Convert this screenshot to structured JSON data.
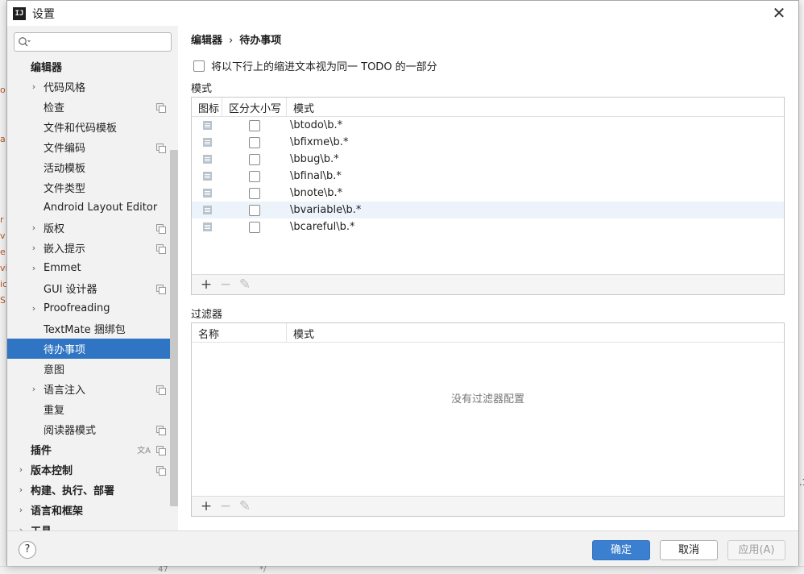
{
  "window": {
    "title": "设置"
  },
  "search": {
    "placeholder": "",
    "value": ""
  },
  "sidebar": {
    "items": [
      {
        "label": "编辑器",
        "bold": true,
        "indent": 0,
        "chevron": false,
        "icon": ""
      },
      {
        "label": "代码风格",
        "indent": 1,
        "chevron": true,
        "icon": ""
      },
      {
        "label": "检查",
        "indent": 1,
        "chevron": false,
        "icon": "project-icon"
      },
      {
        "label": "文件和代码模板",
        "indent": 1,
        "chevron": false,
        "icon": ""
      },
      {
        "label": "文件编码",
        "indent": 1,
        "chevron": false,
        "icon": "project-icon"
      },
      {
        "label": "活动模板",
        "indent": 1,
        "chevron": false,
        "icon": ""
      },
      {
        "label": "文件类型",
        "indent": 1,
        "chevron": false,
        "icon": ""
      },
      {
        "label": "Android Layout Editor",
        "indent": 1,
        "chevron": false,
        "icon": ""
      },
      {
        "label": "版权",
        "indent": 1,
        "chevron": true,
        "icon": "project-icon"
      },
      {
        "label": "嵌入提示",
        "indent": 1,
        "chevron": true,
        "icon": "project-icon"
      },
      {
        "label": "Emmet",
        "indent": 1,
        "chevron": true,
        "icon": ""
      },
      {
        "label": "GUI 设计器",
        "indent": 1,
        "chevron": false,
        "icon": "project-icon"
      },
      {
        "label": "Proofreading",
        "indent": 1,
        "chevron": true,
        "icon": ""
      },
      {
        "label": "TextMate 捆绑包",
        "indent": 1,
        "chevron": false,
        "icon": ""
      },
      {
        "label": "待办事项",
        "indent": 1,
        "chevron": false,
        "icon": "",
        "selected": true
      },
      {
        "label": "意图",
        "indent": 1,
        "chevron": false,
        "icon": ""
      },
      {
        "label": "语言注入",
        "indent": 1,
        "chevron": true,
        "icon": "project-icon"
      },
      {
        "label": "重复",
        "indent": 1,
        "chevron": false,
        "icon": ""
      },
      {
        "label": "阅读器模式",
        "indent": 1,
        "chevron": false,
        "icon": "project-icon"
      },
      {
        "label": "插件",
        "bold": true,
        "indent": 0,
        "chevron": false,
        "icon": "project-icon",
        "extra_icon": "translate-icon"
      },
      {
        "label": "版本控制",
        "bold": true,
        "indent": 0,
        "chevron": true,
        "icon": "project-icon"
      },
      {
        "label": "构建、执行、部署",
        "bold": true,
        "indent": 0,
        "chevron": true,
        "icon": ""
      },
      {
        "label": "语言和框架",
        "bold": true,
        "indent": 0,
        "chevron": true,
        "icon": ""
      },
      {
        "label": "工具",
        "bold": true,
        "indent": 0,
        "chevron": true,
        "icon": ""
      }
    ]
  },
  "breadcrumb": {
    "parent": "编辑器",
    "separator": "›",
    "current": "待办事项"
  },
  "options": {
    "multiline_label": "将以下行上的缩进文本视为同一 TODO 的一部分",
    "multiline_checked": false
  },
  "patterns": {
    "section_label": "模式",
    "columns": {
      "icon": "图标",
      "case": "区分大小写",
      "pattern": "模式"
    },
    "rows": [
      {
        "pattern": "\\btodo\\b.*",
        "case_sensitive": false
      },
      {
        "pattern": "\\bfixme\\b.*",
        "case_sensitive": false
      },
      {
        "pattern": "\\bbug\\b.*",
        "case_sensitive": false
      },
      {
        "pattern": "\\bfinal\\b.*",
        "case_sensitive": false
      },
      {
        "pattern": "\\bnote\\b.*",
        "case_sensitive": false
      },
      {
        "pattern": "\\bvariable\\b.*",
        "case_sensitive": false
      },
      {
        "pattern": "\\bcareful\\b.*",
        "case_sensitive": false
      }
    ],
    "toolbar": {
      "add": "+",
      "remove": "−",
      "edit": "✎"
    }
  },
  "filters": {
    "section_label": "过滤器",
    "columns": {
      "name": "名称",
      "pattern": "模式"
    },
    "empty_text": "没有过滤器配置",
    "toolbar": {
      "add": "+",
      "remove": "−",
      "edit": "✎"
    }
  },
  "footer": {
    "help": "?",
    "ok": "确定",
    "cancel": "取消",
    "apply": "应用(A)"
  },
  "background": {
    "left_chars": [
      "o",
      "a",
      "r",
      "v",
      "e",
      "vi",
      "ic",
      "S"
    ],
    "right_chars": [
      ".1"
    ],
    "bottom_chars": [
      "47",
      "*/"
    ]
  },
  "colors": {
    "selection": "#2f75c3",
    "primary_button": "#3b7fd0"
  }
}
